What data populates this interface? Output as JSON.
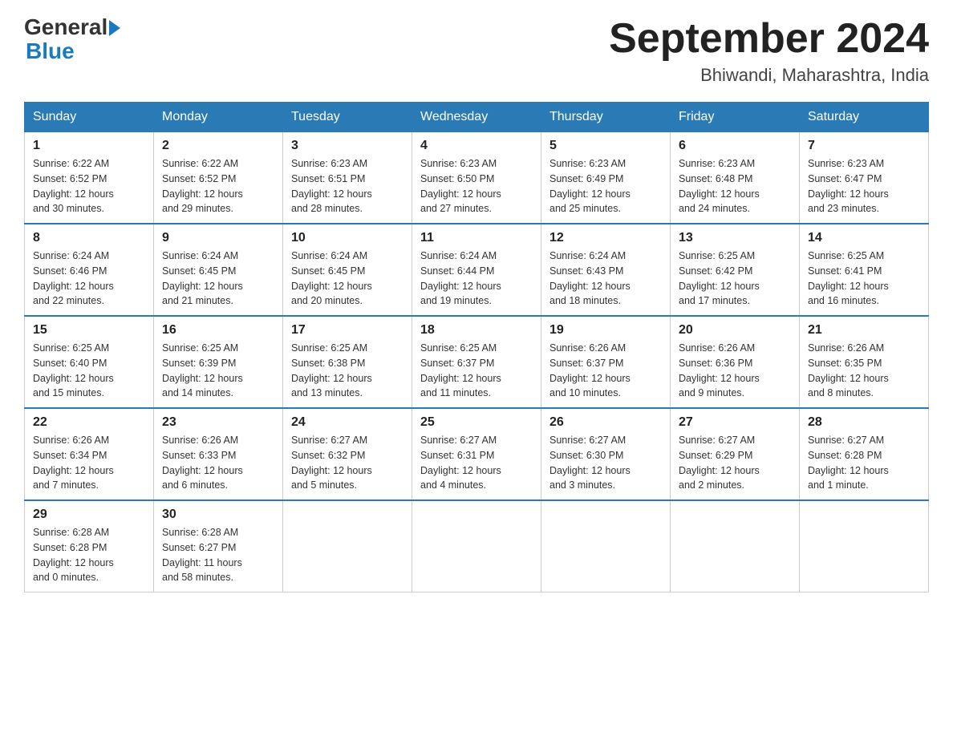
{
  "header": {
    "logo": {
      "general": "General",
      "blue": "Blue",
      "triangle": "▶"
    },
    "title": "September 2024",
    "subtitle": "Bhiwandi, Maharashtra, India"
  },
  "days_of_week": [
    "Sunday",
    "Monday",
    "Tuesday",
    "Wednesday",
    "Thursday",
    "Friday",
    "Saturday"
  ],
  "weeks": [
    [
      {
        "day": "1",
        "sunrise": "6:22 AM",
        "sunset": "6:52 PM",
        "daylight": "12 hours and 30 minutes."
      },
      {
        "day": "2",
        "sunrise": "6:22 AM",
        "sunset": "6:52 PM",
        "daylight": "12 hours and 29 minutes."
      },
      {
        "day": "3",
        "sunrise": "6:23 AM",
        "sunset": "6:51 PM",
        "daylight": "12 hours and 28 minutes."
      },
      {
        "day": "4",
        "sunrise": "6:23 AM",
        "sunset": "6:50 PM",
        "daylight": "12 hours and 27 minutes."
      },
      {
        "day": "5",
        "sunrise": "6:23 AM",
        "sunset": "6:49 PM",
        "daylight": "12 hours and 25 minutes."
      },
      {
        "day": "6",
        "sunrise": "6:23 AM",
        "sunset": "6:48 PM",
        "daylight": "12 hours and 24 minutes."
      },
      {
        "day": "7",
        "sunrise": "6:23 AM",
        "sunset": "6:47 PM",
        "daylight": "12 hours and 23 minutes."
      }
    ],
    [
      {
        "day": "8",
        "sunrise": "6:24 AM",
        "sunset": "6:46 PM",
        "daylight": "12 hours and 22 minutes."
      },
      {
        "day": "9",
        "sunrise": "6:24 AM",
        "sunset": "6:45 PM",
        "daylight": "12 hours and 21 minutes."
      },
      {
        "day": "10",
        "sunrise": "6:24 AM",
        "sunset": "6:45 PM",
        "daylight": "12 hours and 20 minutes."
      },
      {
        "day": "11",
        "sunrise": "6:24 AM",
        "sunset": "6:44 PM",
        "daylight": "12 hours and 19 minutes."
      },
      {
        "day": "12",
        "sunrise": "6:24 AM",
        "sunset": "6:43 PM",
        "daylight": "12 hours and 18 minutes."
      },
      {
        "day": "13",
        "sunrise": "6:25 AM",
        "sunset": "6:42 PM",
        "daylight": "12 hours and 17 minutes."
      },
      {
        "day": "14",
        "sunrise": "6:25 AM",
        "sunset": "6:41 PM",
        "daylight": "12 hours and 16 minutes."
      }
    ],
    [
      {
        "day": "15",
        "sunrise": "6:25 AM",
        "sunset": "6:40 PM",
        "daylight": "12 hours and 15 minutes."
      },
      {
        "day": "16",
        "sunrise": "6:25 AM",
        "sunset": "6:39 PM",
        "daylight": "12 hours and 14 minutes."
      },
      {
        "day": "17",
        "sunrise": "6:25 AM",
        "sunset": "6:38 PM",
        "daylight": "12 hours and 13 minutes."
      },
      {
        "day": "18",
        "sunrise": "6:25 AM",
        "sunset": "6:37 PM",
        "daylight": "12 hours and 11 minutes."
      },
      {
        "day": "19",
        "sunrise": "6:26 AM",
        "sunset": "6:37 PM",
        "daylight": "12 hours and 10 minutes."
      },
      {
        "day": "20",
        "sunrise": "6:26 AM",
        "sunset": "6:36 PM",
        "daylight": "12 hours and 9 minutes."
      },
      {
        "day": "21",
        "sunrise": "6:26 AM",
        "sunset": "6:35 PM",
        "daylight": "12 hours and 8 minutes."
      }
    ],
    [
      {
        "day": "22",
        "sunrise": "6:26 AM",
        "sunset": "6:34 PM",
        "daylight": "12 hours and 7 minutes."
      },
      {
        "day": "23",
        "sunrise": "6:26 AM",
        "sunset": "6:33 PM",
        "daylight": "12 hours and 6 minutes."
      },
      {
        "day": "24",
        "sunrise": "6:27 AM",
        "sunset": "6:32 PM",
        "daylight": "12 hours and 5 minutes."
      },
      {
        "day": "25",
        "sunrise": "6:27 AM",
        "sunset": "6:31 PM",
        "daylight": "12 hours and 4 minutes."
      },
      {
        "day": "26",
        "sunrise": "6:27 AM",
        "sunset": "6:30 PM",
        "daylight": "12 hours and 3 minutes."
      },
      {
        "day": "27",
        "sunrise": "6:27 AM",
        "sunset": "6:29 PM",
        "daylight": "12 hours and 2 minutes."
      },
      {
        "day": "28",
        "sunrise": "6:27 AM",
        "sunset": "6:28 PM",
        "daylight": "12 hours and 1 minute."
      }
    ],
    [
      {
        "day": "29",
        "sunrise": "6:28 AM",
        "sunset": "6:28 PM",
        "daylight": "12 hours and 0 minutes."
      },
      {
        "day": "30",
        "sunrise": "6:28 AM",
        "sunset": "6:27 PM",
        "daylight": "11 hours and 58 minutes."
      },
      null,
      null,
      null,
      null,
      null
    ]
  ],
  "labels": {
    "sunrise": "Sunrise:",
    "sunset": "Sunset:",
    "daylight": "Daylight:"
  }
}
